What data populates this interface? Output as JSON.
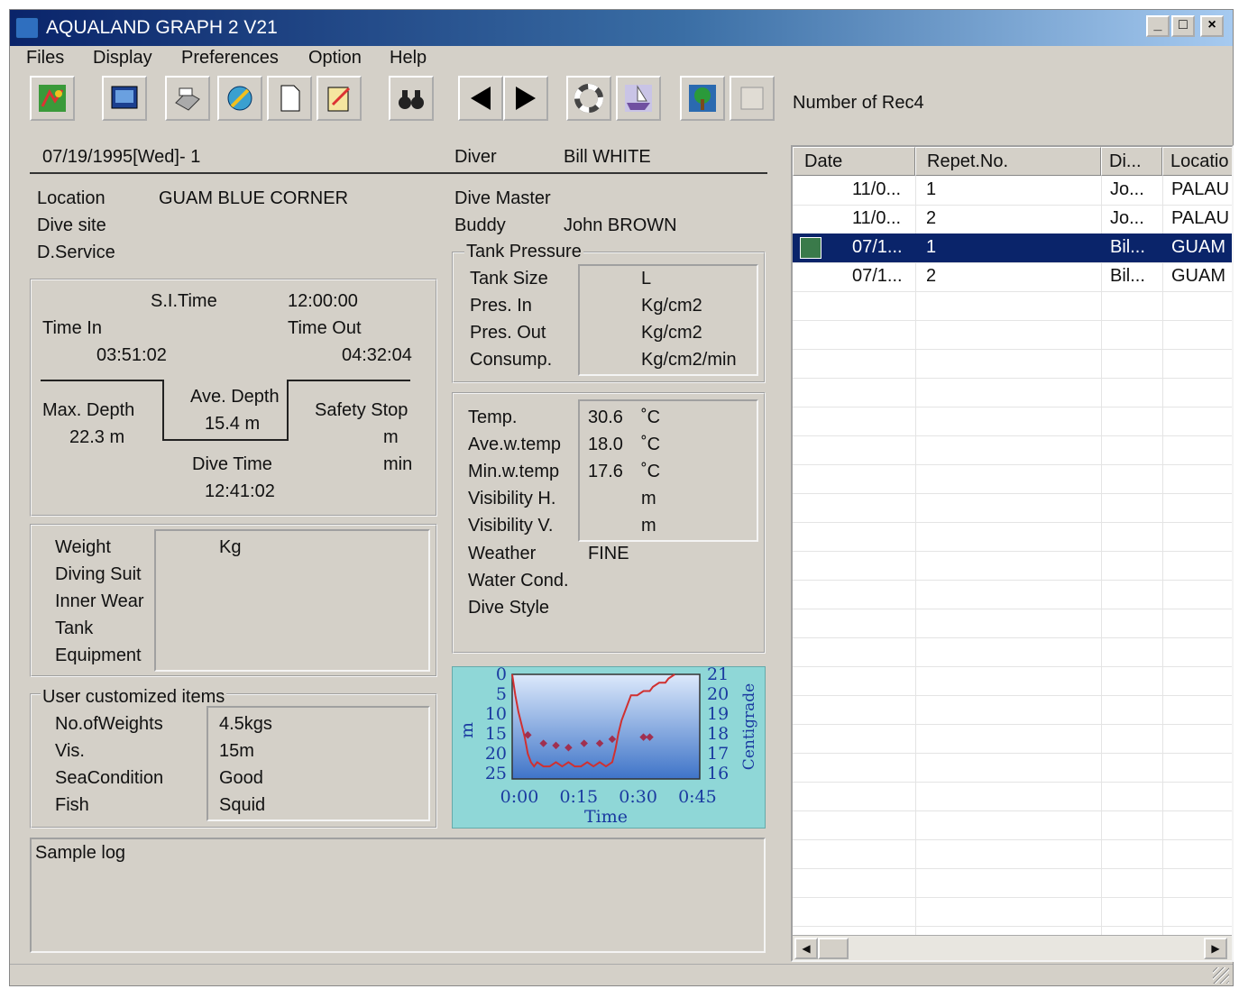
{
  "window": {
    "title": "AQUALAND GRAPH 2 V21"
  },
  "menu": [
    "Files",
    "Display",
    "Preferences",
    "Option",
    "Help"
  ],
  "toolbar": {
    "record_count": "Number of Rec4"
  },
  "header": {
    "date": "07/19/1995[Wed]- 1",
    "diver_label": "Diver",
    "diver": "Bill WHITE"
  },
  "site": {
    "location_label": "Location",
    "location": "GUAM BLUE CORNER",
    "dive_site_label": "Dive site",
    "service_label": "D.Service",
    "dive_master_label": "Dive Master",
    "buddy_label": "Buddy",
    "buddy": "John BROWN"
  },
  "tank": {
    "title": "Tank Pressure",
    "size_label": "Tank Size",
    "size_unit": "L",
    "pres_in_label": "Pres. In",
    "pres_in_unit": "Kg/cm2",
    "pres_out_label": "Pres. Out",
    "pres_out_unit": "Kg/cm2",
    "consump_label": "Consump.",
    "consump_unit": "Kg/cm2/min"
  },
  "time": {
    "si_label": "S.I.Time",
    "si": "12:00:00",
    "in_label": "Time In",
    "in": "03:51:02",
    "out_label": "Time Out",
    "out": "04:32:04",
    "max_depth_label": "Max. Depth",
    "max_depth": "22.3 m",
    "ave_depth_label": "Ave. Depth",
    "ave_depth": "15.4 m",
    "safety_label": "Safety Stop",
    "safety_m": "m",
    "safety_min": "min",
    "dive_time_label": "Dive Time",
    "dive_time": "12:41:02"
  },
  "gear": {
    "weight_label": "Weight",
    "weight_unit": "Kg",
    "suit_label": "Diving Suit",
    "inner_label": "Inner Wear",
    "tank_label": "Tank",
    "equip_label": "Equipment"
  },
  "custom": {
    "title": "User customized items",
    "rows": [
      {
        "label": "No.ofWeights",
        "value": "4.5kgs"
      },
      {
        "label": "Vis.",
        "value": "15m"
      },
      {
        "label": "SeaCondition",
        "value": "Good"
      },
      {
        "label": "Fish",
        "value": "Squid"
      }
    ]
  },
  "env": {
    "temp_label": "Temp.",
    "temp": "30.6",
    "temp_unit": "˚C",
    "ave_label": "Ave.w.temp",
    "ave": "18.0",
    "ave_unit": "˚C",
    "min_label": "Min.w.temp",
    "min": "17.6",
    "min_unit": "˚C",
    "vish_label": "Visibility H.",
    "vish_unit": "m",
    "visv_label": "Visibility V.",
    "visv_unit": "m",
    "weather_label": "Weather",
    "weather": "FINE",
    "water_label": "Water Cond.",
    "style_label": "Dive Style"
  },
  "notes": "Sample log",
  "chart_data": {
    "type": "line",
    "xlabel": "Time",
    "ylabel": "m",
    "y2label": "Centigrade",
    "x_ticks": [
      "0:00",
      "0:15",
      "0:30",
      "0:45"
    ],
    "y_ticks": [
      "0",
      "5",
      "10",
      "15",
      "20",
      "25"
    ],
    "y2_ticks": [
      "21",
      "20",
      "19",
      "18",
      "17",
      "16"
    ],
    "ylim": [
      0,
      25
    ],
    "y2lim": [
      16,
      21
    ],
    "xlim": [
      0,
      60
    ],
    "series": [
      {
        "type": "line",
        "color": "#d03030",
        "x": [
          0,
          1,
          2,
          3,
          4,
          5,
          6,
          7,
          8,
          10,
          12,
          14,
          16,
          18,
          20,
          22,
          24,
          26,
          28,
          30,
          32,
          33,
          34,
          35,
          36,
          37,
          38,
          40,
          42,
          44,
          45,
          47,
          49,
          50,
          52
        ],
        "y": [
          0,
          5,
          9,
          12,
          15,
          19,
          21,
          22,
          21,
          22,
          22,
          21,
          22,
          21,
          22,
          22,
          21,
          22,
          21,
          22,
          21,
          18,
          14,
          11,
          9,
          7,
          5,
          5,
          4,
          4,
          3,
          2,
          2,
          1,
          0
        ]
      },
      {
        "type": "scatter",
        "color": "#a03050",
        "x": [
          5,
          10,
          14,
          18,
          23,
          28,
          32,
          42,
          44
        ],
        "y": [
          14.5,
          16.5,
          17,
          17.5,
          16.5,
          16.5,
          15.5,
          15,
          15
        ]
      }
    ]
  },
  "list": {
    "columns": [
      "Date",
      "Repet.No.",
      "Di...",
      "Locatio"
    ],
    "rows": [
      {
        "date": "11/0...",
        "repet": "1",
        "diver": "Jo...",
        "location": "PALAU"
      },
      {
        "date": "11/0...",
        "repet": "2",
        "diver": "Jo...",
        "location": "PALAU"
      },
      {
        "date": "07/1...",
        "repet": "1",
        "diver": "Bil...",
        "location": "GUAM"
      },
      {
        "date": "07/1...",
        "repet": "2",
        "diver": "Bil...",
        "location": "GUAM"
      }
    ]
  },
  "colors": {
    "title_bar": "#0a246a",
    "selection": "#0a246a",
    "chart_bg": "#8fd7d7",
    "depth_line": "#d03030"
  },
  "icons": [
    "map-icon",
    "screen-icon",
    "print-icon",
    "edit-globe-icon",
    "new-page-icon",
    "notepad-icon",
    "binoculars-icon",
    "prev-arrow-icon",
    "next-arrow-icon",
    "lifebuoy-icon",
    "boat-icon",
    "island-icon",
    "blank-icon"
  ]
}
